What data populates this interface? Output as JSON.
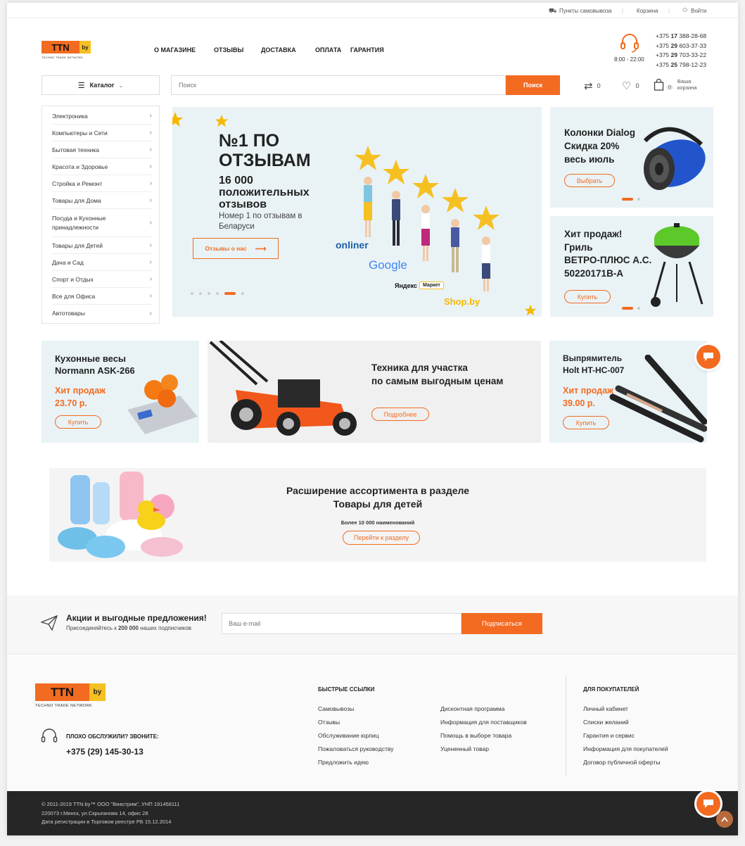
{
  "topbar": {
    "pickup": "Пункты самовывоза",
    "cart": "Корзина",
    "login": "Войти"
  },
  "logo": {
    "text": "TTN",
    "suffix": "by",
    "tagline": "TECHNO TRADE NETWORK"
  },
  "nav": [
    "О МАГАЗИНЕ",
    "ОТЗЫВЫ",
    "ДОСТАВКА",
    "ОПЛАТА",
    "ГАРАНТИЯ"
  ],
  "hours": "8:00 - 22:00",
  "phones": [
    {
      "code": "+375",
      "op": "17",
      "num": "388-28-68"
    },
    {
      "code": "+375",
      "op": "29",
      "num": "603-37-33"
    },
    {
      "code": "+375",
      "op": "29",
      "num": "703-33-22"
    },
    {
      "code": "+375",
      "op": "25",
      "num": "798-12-23"
    }
  ],
  "catalog_label": "Каталог",
  "search": {
    "placeholder": "Поиск",
    "button": "Поиск"
  },
  "header_icons": {
    "compare_count": "0",
    "wish_count": "0",
    "cart_count": "0",
    "cart_label_1": "Ваша",
    "cart_label_2": "корзина"
  },
  "categories": [
    "Электроника",
    "Компьютеры и Сети",
    "Бытовая техника",
    "Красота и Здоровье",
    "Стройка и Ремонт",
    "Товары для Дома",
    "Посуда и Кухонные принадлежности",
    "Товары для Детей",
    "Дача и Сад",
    "Спорт и Отдых",
    "Все для Офиса",
    "Автотовары"
  ],
  "hero": {
    "title_1": "№1 ПО",
    "title_2": "ОТЗЫВАМ",
    "sub_1": "16 000",
    "sub_2": "положительных",
    "sub_3": "отзывов",
    "desc_1": "Номер 1 по отзывам в",
    "desc_2": "Беларуси",
    "button": "Отзывы о нас",
    "brands": [
      "onliner",
      "Google",
      "Яндекс",
      "Маркет",
      "Shop.by"
    ]
  },
  "side_banner_1": {
    "l1": "Колонки Dialog",
    "l2": "Скидка 20%",
    "l3": "весь июль",
    "button": "Выбрать"
  },
  "side_banner_2": {
    "l1": "Хит продаж!",
    "l2": "Гриль",
    "l3": "ВЕТРО-ПЛЮС А.С.",
    "l4": "50220171В-А",
    "button": "Купить"
  },
  "promo_scales": {
    "l1": "Кухонные весы",
    "l2": "Normann ASK-266",
    "hit": "Хит продаж",
    "price": "23.70 р.",
    "button": "Купить"
  },
  "promo_garden": {
    "l1": "Техника для участка",
    "l2": "по самым выгодным ценам",
    "button": "Подробнее"
  },
  "promo_straightener": {
    "l1": "Выпрямитель",
    "l2": "Holt HT-HC-007",
    "hit": "Хит продаж",
    "price": "39.00 р.",
    "button": "Купить"
  },
  "kids_banner": {
    "l1": "Расширение ассортимента в разделе",
    "l2": "Товары для детей",
    "small": "Более 10 000 наименований",
    "button": "Перейти к разделу"
  },
  "subscribe": {
    "title": "Акции и выгодные предложения!",
    "sub_pre": "Присоединяйтесь к",
    "sub_bold": "200 000",
    "sub_post": "наших подписчиков",
    "placeholder": "Ваш e-mail",
    "button": "Подписаться"
  },
  "footer": {
    "complaint": "ПЛОХО ОБСЛУЖИЛИ? ЗВОНИТЕ:",
    "complaint_phone": "+375 (29) 145-30-13",
    "quick_title": "БЫСТРЫЕ ССЫЛКИ",
    "quick_col1": [
      "Самовывозы",
      "Отзывы",
      "Обслуживание юрлиц",
      "Пожаловаться руководству",
      "Предложить идею"
    ],
    "quick_col2": [
      "Дисконтная программа",
      "Информация для поставщиков",
      "Помощь в выборе товара",
      "Уцененный товар"
    ],
    "buyers_title": "ДЛЯ ПОКУПАТЕЛЕЙ",
    "buyers": [
      "Личный кабинет",
      "Списки желаний",
      "Гарантия и сервис",
      "Информация для покупателей",
      "Договор публичной оферты"
    ]
  },
  "bottom": {
    "l1": "© 2011-2019 TTN.by™ ООО \"Виастрим\", УНП 191458111",
    "l2": "220073 г.Минск, ул.Скрыганова 14, офис 28",
    "l3": "Дата регистрации в Торговом реестре РБ 15.12.2014"
  },
  "colors": {
    "accent": "#f26b21",
    "banner_bg": "#e9f3f6",
    "footer_dark": "#262626"
  }
}
